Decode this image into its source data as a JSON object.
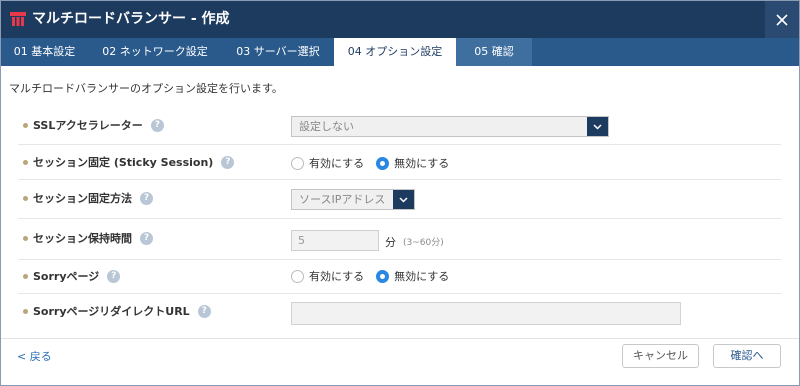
{
  "window": {
    "title": "マルチロードバランサー - 作成"
  },
  "tabs": [
    {
      "label": "01 基本設定"
    },
    {
      "label": "02 ネットワーク設定"
    },
    {
      "label": "03 サーバー選択"
    },
    {
      "label": "04 オプション設定"
    },
    {
      "label": "05 確認"
    }
  ],
  "main": {
    "description": "マルチロードバランサーのオプション設定を行います。",
    "ssl": {
      "label": "SSLアクセラレーター",
      "value": "設定しない"
    },
    "sticky": {
      "label": "セッション固定 (Sticky Session)",
      "options": [
        "有効にする",
        "無効にする"
      ],
      "selected": "無効にする"
    },
    "sticky_method": {
      "label": "セッション固定方法",
      "value": "ソースIPアドレス"
    },
    "keep_time": {
      "label": "セッション保持時間",
      "value": "5",
      "unit": "分",
      "range": "(3~60分)"
    },
    "sorry": {
      "label": "Sorryページ",
      "options": [
        "有効にする",
        "無効にする"
      ],
      "selected": "無効にする"
    },
    "sorry_url": {
      "label": "SorryページリダイレクトURL",
      "value": ""
    }
  },
  "footer": {
    "back": "< 戻る",
    "cancel": "キャンセル",
    "confirm": "確認へ"
  },
  "colors": {
    "titlebar": "#1d3a5f",
    "tabbar": "#2a5a8c",
    "accent": "#2b87e0"
  },
  "icons": {
    "logo": "balancer-logo-icon",
    "close": "close-icon",
    "help": "help-icon",
    "caret": "chevron-down-icon"
  }
}
